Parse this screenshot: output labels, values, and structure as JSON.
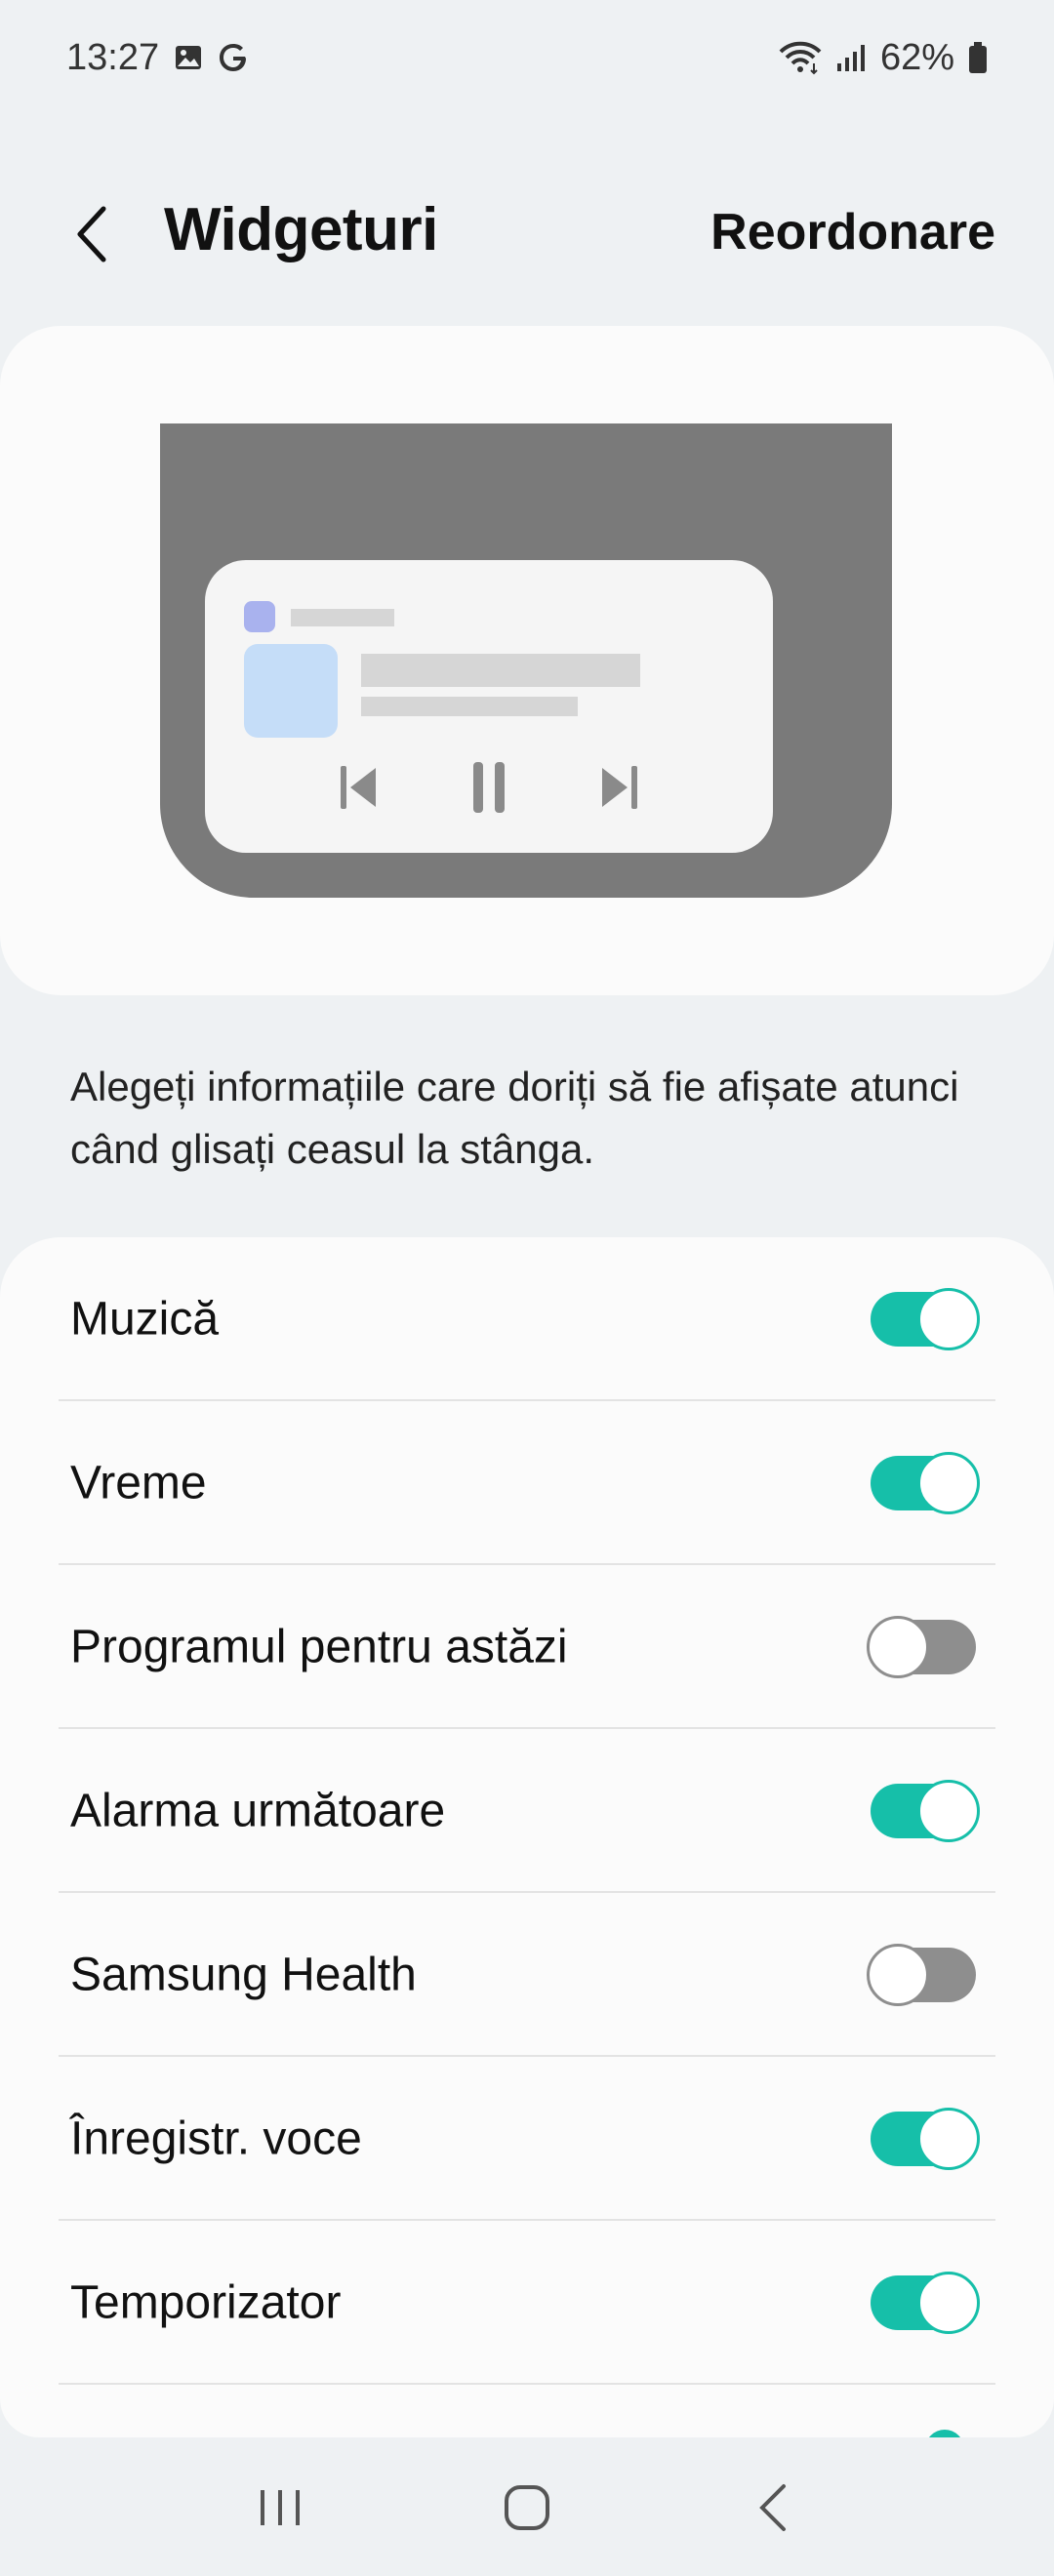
{
  "status_bar": {
    "time": "13:27",
    "left_icons": [
      "image-icon",
      "google-icon"
    ],
    "right_icons": [
      "wifi-icon",
      "signal-icon",
      "battery-icon"
    ],
    "battery": "62%"
  },
  "header": {
    "title": "Widgeturi",
    "action_label": "Reordonare",
    "back_icon": "chevron-left-icon"
  },
  "preview": {
    "controls": [
      "previous-icon",
      "pause-icon",
      "next-icon"
    ]
  },
  "description": "Alegeți informațiile care doriți să fie afișate atunci când glisați ceasul la stânga.",
  "widgets": [
    {
      "label": "Muzică",
      "enabled": true
    },
    {
      "label": "Vreme",
      "enabled": true
    },
    {
      "label": "Programul pentru astăzi",
      "enabled": false
    },
    {
      "label": "Alarma următoare",
      "enabled": true
    },
    {
      "label": "Samsung Health",
      "enabled": false
    },
    {
      "label": "Înregistr. voce",
      "enabled": true
    },
    {
      "label": "Temporizator",
      "enabled": true
    }
  ],
  "colors": {
    "accent": "#16bfa9",
    "switch_off": "#8e8e8e",
    "background": "#eef1f3",
    "card": "#fbfbfb"
  },
  "nav_bar": {
    "buttons": [
      "recents-icon",
      "home-icon",
      "back-icon"
    ]
  }
}
